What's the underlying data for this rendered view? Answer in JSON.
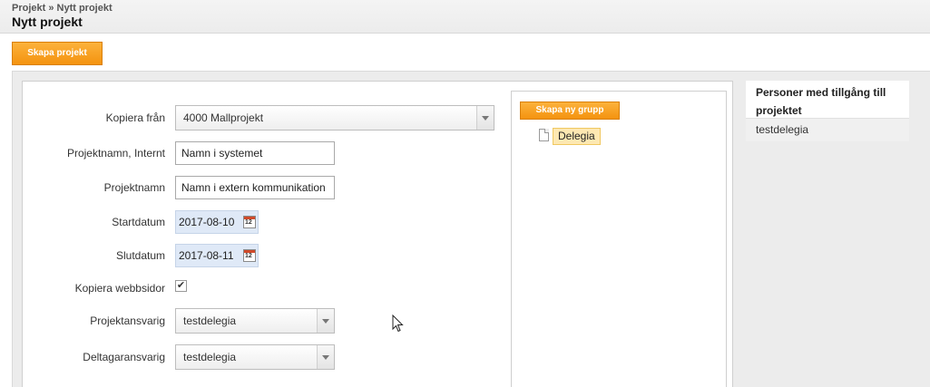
{
  "header": {
    "breadcrumb": "Projekt » Nytt projekt",
    "title": "Nytt projekt"
  },
  "toolbar": {
    "create_project_label": "Skapa projekt"
  },
  "form": {
    "copy_from": {
      "label": "Kopiera från",
      "value": "4000 Mallprojekt"
    },
    "internal_name": {
      "label": "Projektnamn, Internt",
      "value": "Namn i systemet"
    },
    "project_name": {
      "label": "Projektnamn",
      "value": "Namn i extern kommunikation"
    },
    "start_date": {
      "label": "Startdatum",
      "value": "2017-08-10"
    },
    "end_date": {
      "label": "Slutdatum",
      "value": "2017-08-11"
    },
    "copy_web": {
      "label": "Kopiera webbsidor",
      "checked": true,
      "mark": "✔"
    },
    "project_owner": {
      "label": "Projektansvarig",
      "value": "testdelegia"
    },
    "participant_owner": {
      "label": "Deltagaransvarig",
      "value": "testdelegia"
    }
  },
  "groups": {
    "create_group_label": "Skapa ny grupp",
    "items": [
      {
        "label": "Delegia"
      }
    ]
  },
  "access": {
    "header": "Personer med tillgång till projektet",
    "users": [
      "testdelegia"
    ]
  },
  "colors": {
    "accent": "#f4930f",
    "date_bg": "#dfe9f7",
    "selected_node": "#fde8b2"
  }
}
